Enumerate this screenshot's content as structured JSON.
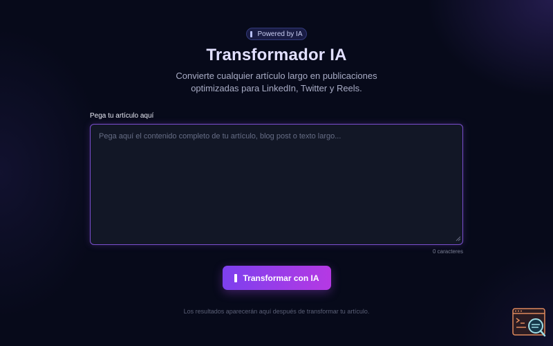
{
  "badge": {
    "icon": "bar-icon",
    "text": "Powered by IA"
  },
  "header": {
    "title": "Transformador IA",
    "subtitle": "Convierte cualquier artículo largo en publicaciones optimizadas para LinkedIn, Twitter y Reels."
  },
  "form": {
    "label": "Pega tu artículo aquí",
    "textarea_value": "",
    "textarea_placeholder": "Pega aquí el contenido completo de tu artículo, blog post o texto largo...",
    "char_count": "0 caracteres"
  },
  "cta": {
    "icon": "bar-icon",
    "label": "Transformar con IA"
  },
  "results": {
    "hint": "Los resultados aparecerán aquí después de transformar tu artículo."
  },
  "corner_widget": {
    "icon": "console-search-icon"
  },
  "colors": {
    "background": "#070a1a",
    "accent_start": "#7d40ee",
    "accent_end": "#b539e3",
    "textarea_border": "#7b4fcf",
    "title": "#e2e0ff"
  }
}
